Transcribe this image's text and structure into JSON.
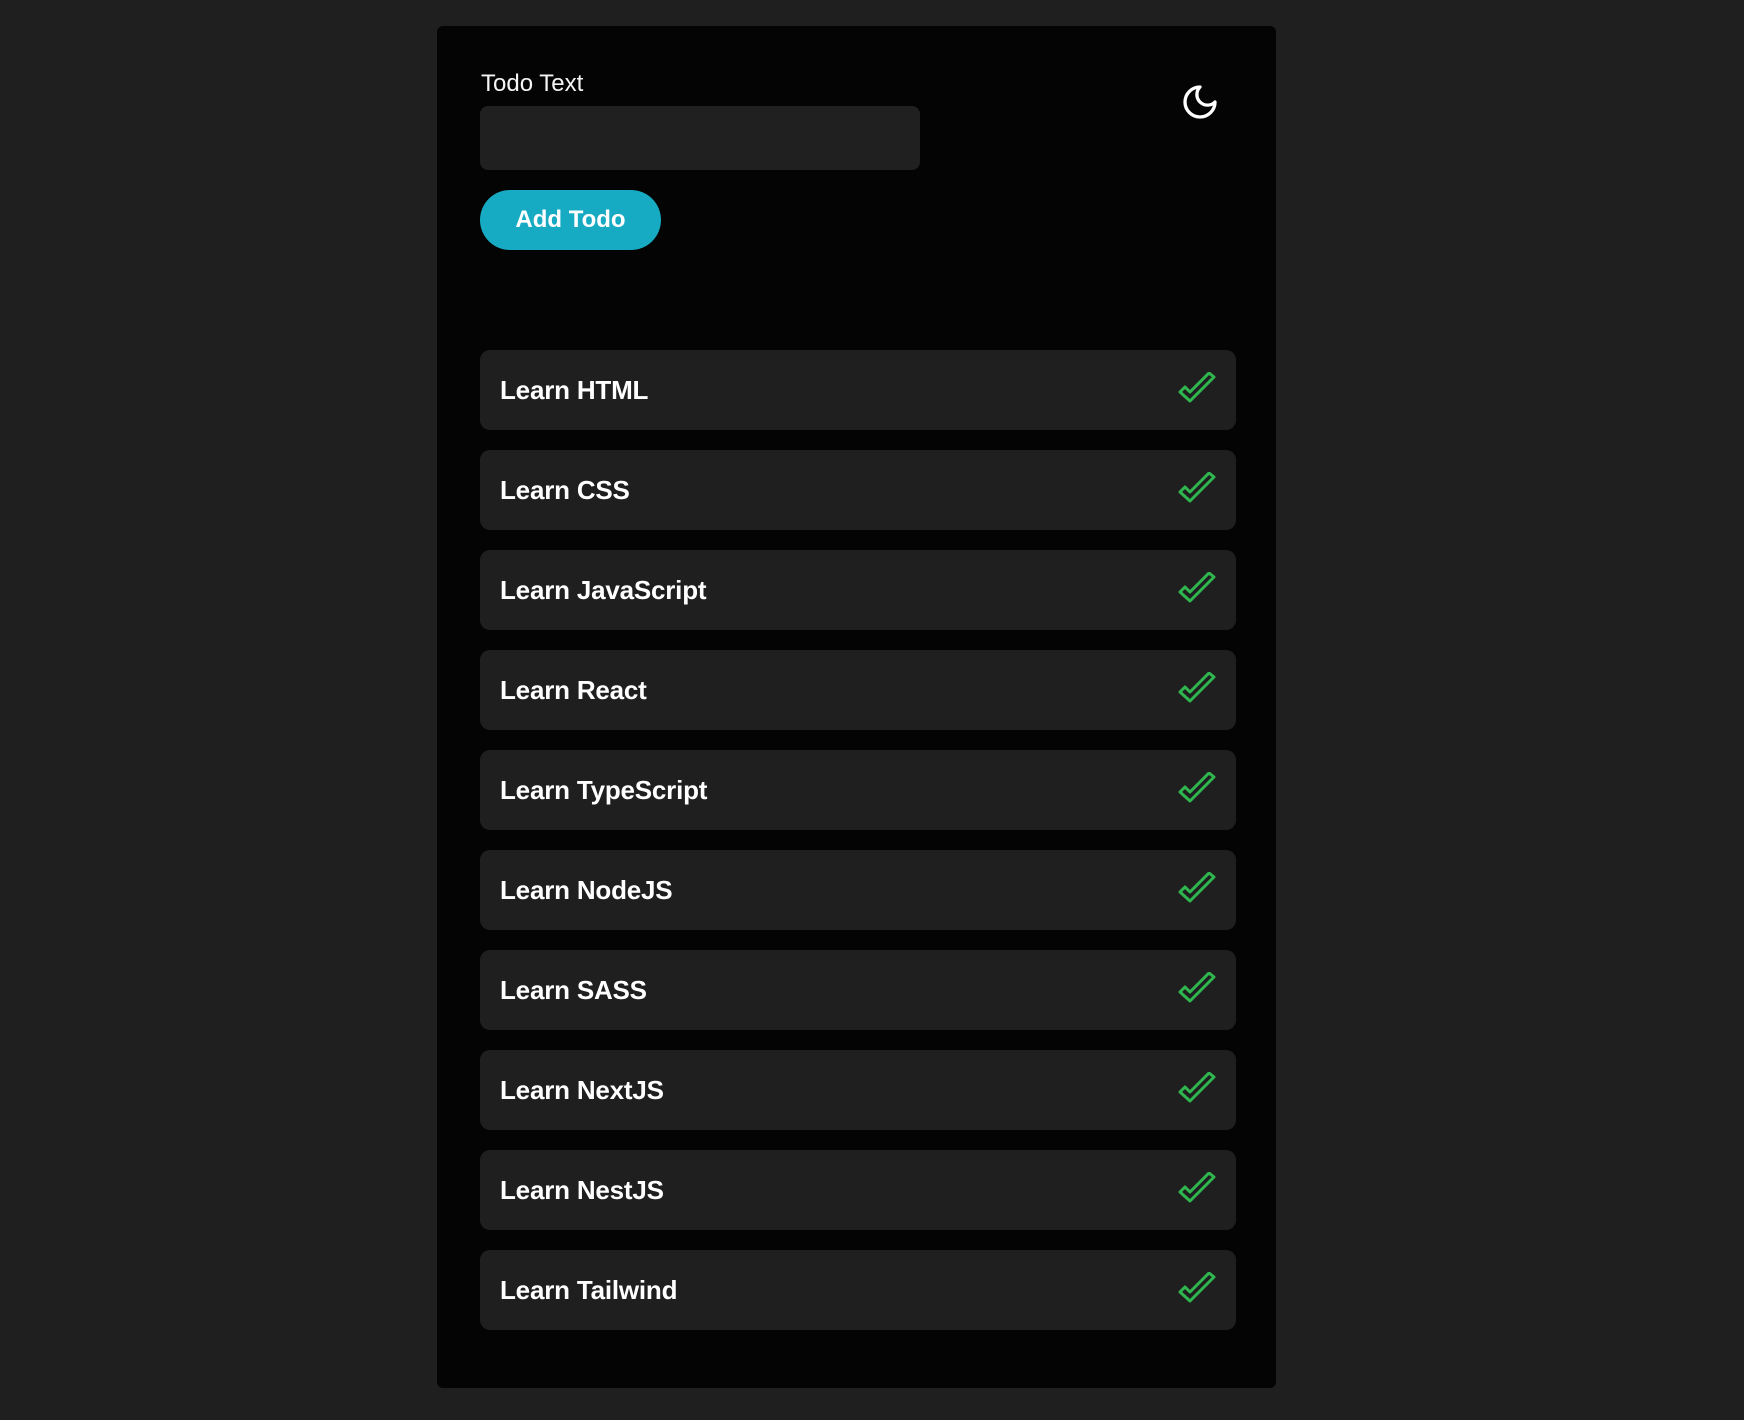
{
  "form": {
    "label": "Todo Text",
    "input_value": "",
    "input_placeholder": "",
    "add_button_label": "Add Todo"
  },
  "theme_toggle": {
    "icon": "moon-icon"
  },
  "todos": [
    {
      "text": "Learn HTML",
      "status_icon": "check-icon",
      "completed": true
    },
    {
      "text": "Learn CSS",
      "status_icon": "check-icon",
      "completed": true
    },
    {
      "text": "Learn JavaScript",
      "status_icon": "check-icon",
      "completed": true
    },
    {
      "text": "Learn React",
      "status_icon": "check-icon",
      "completed": true
    },
    {
      "text": "Learn TypeScript",
      "status_icon": "check-icon",
      "completed": true
    },
    {
      "text": "Learn NodeJS",
      "status_icon": "check-icon",
      "completed": true
    },
    {
      "text": "Learn SASS",
      "status_icon": "check-icon",
      "completed": true
    },
    {
      "text": "Learn NextJS",
      "status_icon": "check-icon",
      "completed": true
    },
    {
      "text": "Learn NestJS",
      "status_icon": "check-icon",
      "completed": true
    },
    {
      "text": "Learn Tailwind",
      "status_icon": "check-icon",
      "completed": true
    }
  ],
  "colors": {
    "page_background": "#1f1f1f",
    "card_background": "#040404",
    "input_background": "#202020",
    "item_background": "#1f1f1f",
    "accent": "#17abc3",
    "check_green": "#2fb64f",
    "text": "#ffffff"
  }
}
